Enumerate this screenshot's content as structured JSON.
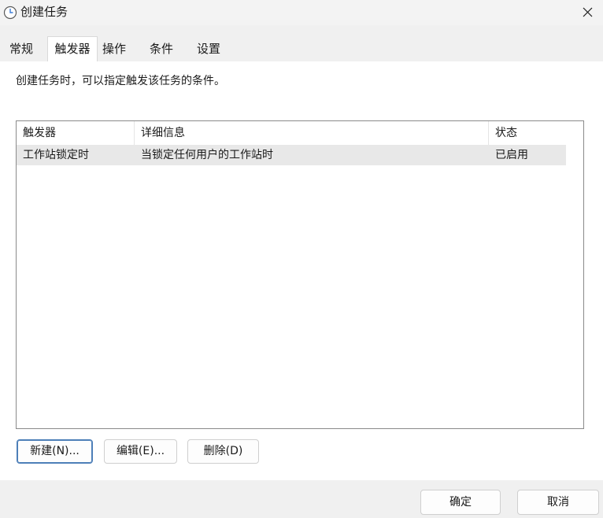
{
  "window": {
    "title": "创建任务",
    "icon": "clock-icon"
  },
  "tabs": [
    {
      "label": "常规"
    },
    {
      "label": "触发器"
    },
    {
      "label": "操作"
    },
    {
      "label": "条件"
    },
    {
      "label": "设置"
    }
  ],
  "active_tab": "触发器",
  "hint": "创建任务时，可以指定触发该任务的条件。",
  "triggers": {
    "columns": [
      "触发器",
      "详细信息",
      "状态"
    ],
    "rows": [
      {
        "trigger": "工作站锁定时",
        "details": "当锁定任何用户的工作站时",
        "status": "已启用"
      }
    ]
  },
  "buttons": {
    "new": "新建(N)...",
    "edit": "编辑(E)...",
    "delete": "删除(D)",
    "ok": "确定",
    "cancel": "取消"
  },
  "colors": {
    "primary_border": "#4d7fb8",
    "selected_row": "#e8e8e8"
  }
}
